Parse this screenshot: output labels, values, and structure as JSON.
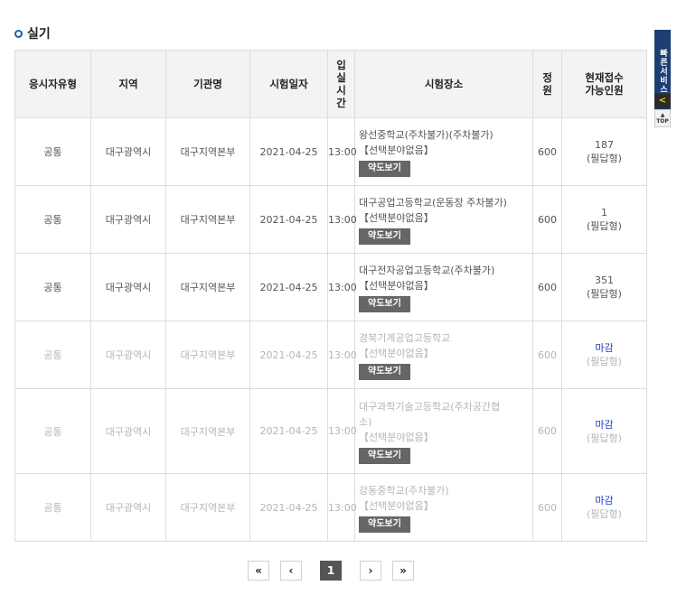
{
  "section": {
    "title": "실기"
  },
  "table": {
    "headers": {
      "type": "응시자유형",
      "region": "지역",
      "agency": "기관명",
      "date": "시험일자",
      "time_lines": [
        "입",
        "실",
        "시",
        "간"
      ],
      "place": "시험장소",
      "capacity_lines": [
        "정",
        "원"
      ],
      "available_lines": [
        "현재접수",
        "가능인원"
      ]
    },
    "map_label": "약도보기",
    "rows": [
      {
        "type": "공통",
        "region": "대구광역시",
        "agency": "대구지역본부",
        "date": "2021-04-25",
        "time": "13:00",
        "place_lines": [
          "왕선중학교(주차불가)(주차불가)",
          "【선택분야없음】"
        ],
        "capacity": "600",
        "available": "187",
        "note": "(필답형)",
        "closed": false
      },
      {
        "type": "공통",
        "region": "대구광역시",
        "agency": "대구지역본부",
        "date": "2021-04-25",
        "time": "13:00",
        "place_lines": [
          "대구공업고등학교(운동장 주차불가)",
          "【선택분야없음】"
        ],
        "capacity": "600",
        "available": "1",
        "note": "(필답형)",
        "closed": false
      },
      {
        "type": "공통",
        "region": "대구광역시",
        "agency": "대구지역본부",
        "date": "2021-04-25",
        "time": "13:00",
        "place_lines": [
          "대구전자공업고등학교(주차불가)",
          "【선택분야없음】"
        ],
        "capacity": "600",
        "available": "351",
        "note": "(필답형)",
        "closed": false
      },
      {
        "type": "공통",
        "region": "대구광역시",
        "agency": "대구지역본부",
        "date": "2021-04-25",
        "time": "13:00",
        "place_lines": [
          "경북기계공업고등학교",
          "【선택분야없음】"
        ],
        "capacity": "600",
        "available": "마감",
        "note": "(필답형)",
        "closed": true
      },
      {
        "type": "공통",
        "region": "대구광역시",
        "agency": "대구지역본부",
        "date": "2021-04-25",
        "time": "13:00",
        "place_lines": [
          "대구과학기술고등학교(주차공간협",
          "소)",
          "【선택분야없음】"
        ],
        "capacity": "600",
        "available": "마감",
        "note": "(필답형)",
        "closed": true
      },
      {
        "type": "공통",
        "region": "대구광역시",
        "agency": "대구지역본부",
        "date": "2021-04-25",
        "time": "13:00",
        "place_lines": [
          "강동중학교(주차불가)",
          "【선택분야없음】"
        ],
        "capacity": "600",
        "available": "마감",
        "note": "(필답형)",
        "closed": true
      }
    ]
  },
  "pagination": {
    "first": "«",
    "prev": "‹",
    "current": "1",
    "next": "›",
    "last": "»"
  },
  "quick_service": {
    "label": "빠른서비스",
    "toggle": "<",
    "top_lines": [
      "▲",
      "TOP"
    ]
  },
  "colors": {
    "header_bg": "#f3f3f3",
    "button_bg": "#666666",
    "closed_text": "#1f3fbf",
    "quick_bg": "#1b3f73"
  },
  "icons": {
    "section_bullet": "circle-bullet-icon",
    "quick_toggle": "chevron-left-icon",
    "top": "arrow-up-icon"
  }
}
